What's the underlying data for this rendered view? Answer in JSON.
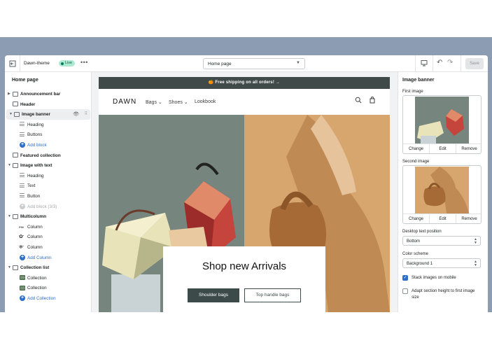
{
  "topbar": {
    "theme_name": "Dawn-theme",
    "status": "Live",
    "more_label": "•••",
    "page_select": "Home page",
    "save_label": "Save"
  },
  "sidebar": {
    "title": "Home page",
    "items": [
      {
        "type": "sec",
        "label": "Announcement bar",
        "chev": true
      },
      {
        "type": "sec",
        "label": "Header",
        "chev": false
      },
      {
        "type": "sec",
        "label": "Image banner",
        "chev": true,
        "active": true
      },
      {
        "type": "child",
        "label": "Heading"
      },
      {
        "type": "child",
        "label": "Buttons"
      },
      {
        "type": "add",
        "label": "Add block"
      },
      {
        "type": "sec",
        "label": "Featured collection",
        "chev": false
      },
      {
        "type": "sec",
        "label": "Image with text",
        "chev": true
      },
      {
        "type": "child",
        "label": "Heading"
      },
      {
        "type": "child",
        "label": "Text"
      },
      {
        "type": "child",
        "label": "Button"
      },
      {
        "type": "add-disabled",
        "label": "Add block (3/3)"
      },
      {
        "type": "sec",
        "label": "Multicolumn",
        "chev": true
      },
      {
        "type": "col",
        "label": "Column",
        "icon": "pin-icon"
      },
      {
        "type": "col",
        "label": "Column",
        "icon": "flower-icon"
      },
      {
        "type": "col",
        "label": "Column",
        "icon": "snowflake-icon"
      },
      {
        "type": "add",
        "label": "Add Column"
      },
      {
        "type": "sec",
        "label": "Collection list",
        "chev": true
      },
      {
        "type": "img",
        "label": "Collection"
      },
      {
        "type": "img",
        "label": "Collection"
      },
      {
        "type": "add",
        "label": "Add Collection"
      }
    ]
  },
  "preview": {
    "announcement": "🍊 Free shipping on all orders!  →",
    "logo": "DAWN",
    "nav": [
      "Bags ⌄",
      "Shoes ⌄",
      "Lookbook"
    ],
    "hero_title": "Shop new Arrivals",
    "btn_primary": "Shoulder bags",
    "btn_secondary": "Top handle bags"
  },
  "settings": {
    "title": "Image banner",
    "first_image_label": "First image",
    "second_image_label": "Second image",
    "image_actions": [
      "Change",
      "Edit",
      "Remove"
    ],
    "position_label": "Desktop text position",
    "position_value": "Bottom",
    "scheme_label": "Color scheme",
    "scheme_value": "Background 1",
    "stack_label": "Stack images on mobile",
    "stack_checked": true,
    "adapt_label": "Adapt section height to first image size",
    "adapt_checked": false
  },
  "colors": {
    "accent": "#2c6ecb",
    "announcement_bg": "#3f4a49",
    "hero_left": "#76857d",
    "hero_right": "#d4a46d",
    "band": "#8c9cb3"
  }
}
